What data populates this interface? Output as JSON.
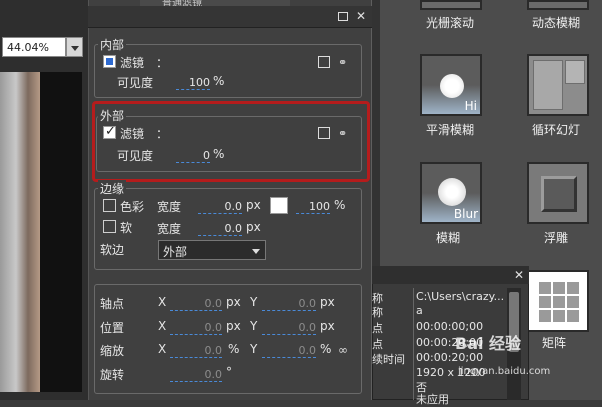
{
  "toolbar": {
    "zoom_value": "44.04%"
  },
  "panel": {
    "top_strip_label": "普通滤镜",
    "inner": {
      "title": "内部",
      "filter_label": "滤镜",
      "colon": "：",
      "visibility_label": "可见度",
      "visibility_value": "100",
      "visibility_unit": "%"
    },
    "outer": {
      "title": "外部",
      "filter_label": "滤镜",
      "colon": "：",
      "visibility_label": "可见度",
      "visibility_value": "0",
      "visibility_unit": "%"
    },
    "edge": {
      "title": "边缘",
      "color_label": "色彩",
      "soft_label": "软",
      "width_label": "宽度",
      "width1_value": "0.0",
      "width2_value": "0.0",
      "unit_px": "px",
      "opacity_value": "100",
      "opacity_unit": "%",
      "soft_edge_label": "软边",
      "soft_edge_selected": "外部"
    },
    "transform": {
      "pivot_label": "轴点",
      "position_label": "位置",
      "scale_label": "缩放",
      "rotate_label": "旋转",
      "x_label": "X",
      "y_label": "Y",
      "pivot_x": "0.0",
      "pivot_y": "0.0",
      "position_x": "0.0",
      "position_y": "0.0",
      "scale_x": "0.0",
      "scale_y": "0.0",
      "rotate": "0.0",
      "unit_px": "px",
      "unit_pct": "%",
      "unit_deg": "°"
    }
  },
  "effects": {
    "items": [
      {
        "label": "光栅滚动"
      },
      {
        "label": "动态模糊"
      },
      {
        "label": "平滑模糊",
        "thumb_text": "Hi"
      },
      {
        "label": "循环幻灯"
      },
      {
        "label": "模糊",
        "thumb_text": "Blur"
      },
      {
        "label": "浮雕"
      },
      {
        "label": "矩阵"
      }
    ]
  },
  "info": {
    "rows": [
      {
        "key": "称",
        "value": "C:\\Users\\crazy..."
      },
      {
        "key": "称",
        "value": "a"
      },
      {
        "key": "点",
        "value": "00:00:00;00"
      },
      {
        "key": "点",
        "value": "00:00:20;00"
      },
      {
        "key": "续时间",
        "value": "00:00:20;00"
      },
      {
        "key": "",
        "value": "1920 x 1200"
      },
      {
        "key": "",
        "value": "否"
      },
      {
        "key": "",
        "value": "未应用"
      }
    ]
  },
  "watermark": {
    "text": "Bai 经验",
    "sub": "jingyan.baidu.com"
  },
  "colors": {
    "highlight": "#b51c1c",
    "panel_bg": "#404040",
    "accent_blue": "#2e6ad0"
  }
}
